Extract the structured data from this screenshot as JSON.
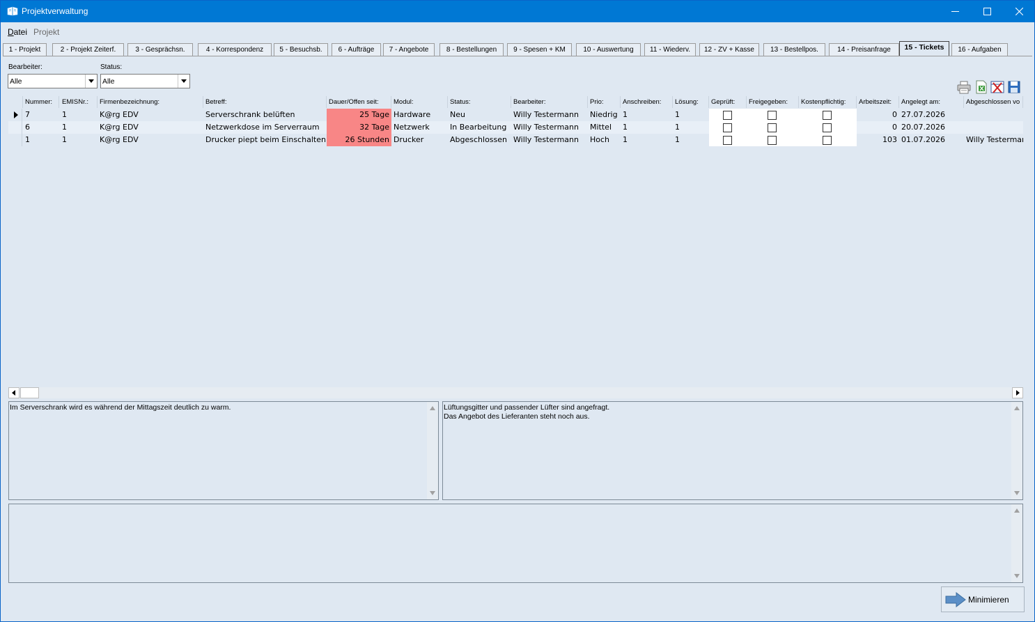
{
  "window": {
    "title": "Projektverwaltung",
    "accent": "#0078d4"
  },
  "menu": {
    "datei_first": "D",
    "datei_rest": "atei",
    "projekt": "Projekt"
  },
  "tabs": [
    {
      "label": "1 - Projekt"
    },
    {
      "label": "2 - Projekt Zeiterf."
    },
    {
      "label": "3 - Gesprächsn."
    },
    {
      "label": "4 - Korrespondenz"
    },
    {
      "label": "5 - Besuchsb."
    },
    {
      "label": "6 - Aufträge"
    },
    {
      "label": "7 - Angebote"
    },
    {
      "label": "8 - Bestellungen"
    },
    {
      "label": "9 - Spesen + KM"
    },
    {
      "label": "10 - Auswertung"
    },
    {
      "label": "11 - Wiederv."
    },
    {
      "label": "12 - ZV + Kasse"
    },
    {
      "label": "13 - Bestellpos."
    },
    {
      "label": "14 - Preisanfrage"
    },
    {
      "label": "15 - Tickets",
      "active": true
    },
    {
      "label": "16 - Aufgaben"
    }
  ],
  "filters": {
    "bearbeiter_label": "Bearbeiter:",
    "bearbeiter_value": "Alle",
    "status_label": "Status:",
    "status_value": "Alle"
  },
  "toolbar": {
    "icons": [
      "print-icon",
      "export-excel-icon",
      "delete-icon",
      "save-icon"
    ]
  },
  "grid": {
    "headers": [
      "Nummer:",
      "EMISNr.:",
      "Firmenbezeichnung:",
      "Betreff:",
      "Dauer/Offen seit:",
      "Modul:",
      "Status:",
      "Bearbeiter:",
      "Prio:",
      "Anschreiben:",
      "Lösung:",
      "Geprüft:",
      "Freigegeben:",
      "Kostenpflichtig:",
      "Arbeitszeit:",
      "Angelegt am:",
      "Abgeschlossen vo"
    ],
    "rows": [
      {
        "nummer": "7",
        "emis": "1",
        "firma": "K@rg EDV",
        "betreff": "Serverschrank belüften",
        "dauer": "25 Tage",
        "modul": "Hardware",
        "status": "Neu",
        "bearbeiter": "Willy Testermann",
        "prio": "Niedrig",
        "anschreiben": "1",
        "loesung": "1",
        "arbeitszeit": "0",
        "angelegt": "27.07.2026",
        "abgeschlossen": ""
      },
      {
        "nummer": "6",
        "emis": "1",
        "firma": "K@rg EDV",
        "betreff": "Netzwerkdose im Serverraum",
        "dauer": "32 Tage",
        "modul": "Netzwerk",
        "status": "In Bearbeitung",
        "bearbeiter": "Willy Testermann",
        "prio": "Mittel",
        "anschreiben": "1",
        "loesung": "1",
        "arbeitszeit": "0",
        "angelegt": "20.07.2026",
        "abgeschlossen": ""
      },
      {
        "nummer": "1",
        "emis": "1",
        "firma": "K@rg EDV",
        "betreff": "Drucker piept beim Einschalten",
        "dauer": "26 Stunden",
        "modul": "Drucker",
        "status": "Abgeschlossen",
        "bearbeiter": "Willy Testermann",
        "prio": "Hoch",
        "anschreiben": "1",
        "loesung": "1",
        "arbeitszeit": "103",
        "angelegt": "01.07.2026",
        "abgeschlossen": "Willy Testermann"
      }
    ],
    "duration_color": "#f88686"
  },
  "memos": {
    "description": "Im Serverschrank wird es während der Mittagszeit deutlich zu warm.",
    "solution": "Lüftungsgitter und passender Lüfter sind angefragt.\nDas Angebot des Lieferanten steht noch aus.",
    "notes": ""
  },
  "buttons": {
    "minimize": "Minimieren"
  }
}
